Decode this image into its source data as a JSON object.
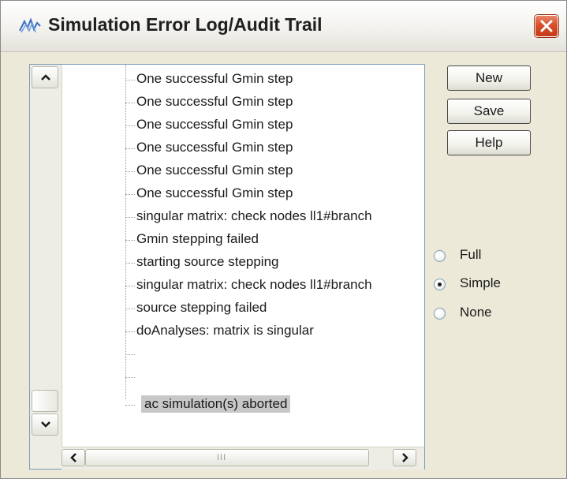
{
  "window": {
    "title": "Simulation Error Log/Audit Trail"
  },
  "log": {
    "rows": [
      {
        "text": "One successful Gmin step"
      },
      {
        "text": "One successful Gmin step"
      },
      {
        "text": "One successful Gmin step"
      },
      {
        "text": "One successful Gmin step"
      },
      {
        "text": "One successful Gmin step"
      },
      {
        "text": "One successful Gmin step"
      },
      {
        "text": "singular matrix:  check nodes ll1#branch"
      },
      {
        "text": "Gmin stepping failed"
      },
      {
        "text": "starting source stepping"
      },
      {
        "text": "singular matrix:  check nodes ll1#branch"
      },
      {
        "text": "source stepping failed"
      },
      {
        "text": "doAnalyses: matrix is singular"
      },
      {
        "text": ""
      },
      {
        "text": ""
      },
      {
        "text": "ac simulation(s) aborted",
        "selected": true
      }
    ],
    "hscroll_grip": "III"
  },
  "buttons": {
    "new": "New",
    "save": "Save",
    "help": "Help"
  },
  "detail_level": {
    "options": [
      "Full",
      "Simple",
      "None"
    ],
    "selected": "Simple"
  },
  "colors": {
    "selection_bg": "#c8c8c8",
    "close_button": "#d9502d",
    "dialog_bg": "#ece9d8"
  },
  "icons": {
    "app": "simulation-wave-icon",
    "close": "close-icon",
    "scroll_up": "chevron-up-icon",
    "scroll_down": "chevron-down-icon",
    "scroll_left": "chevron-left-icon",
    "scroll_right": "chevron-right-icon"
  }
}
